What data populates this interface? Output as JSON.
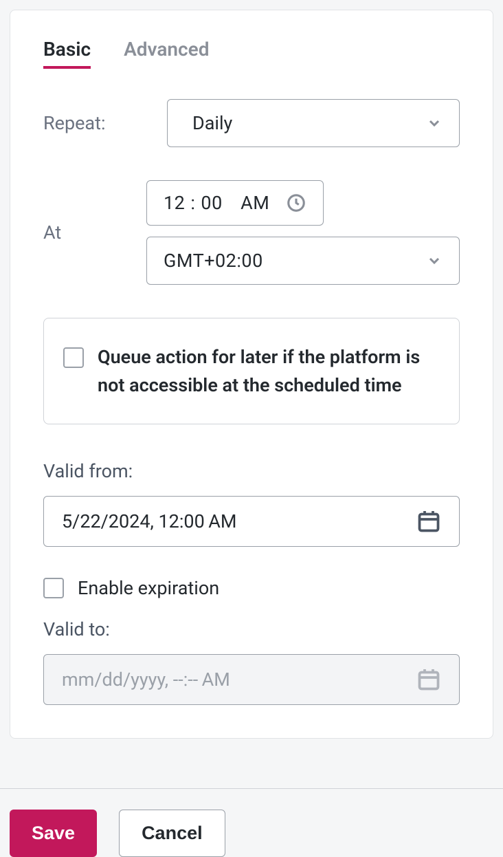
{
  "tabs": {
    "basic": "Basic",
    "advanced": "Advanced"
  },
  "repeat": {
    "label": "Repeat:",
    "value": "Daily"
  },
  "at": {
    "label": "At",
    "hours": "12",
    "minutes": "00",
    "ampm": "AM",
    "timezone": "GMT+02:00"
  },
  "queue": {
    "text": "Queue action for later if the platform is not accessible at the scheduled time"
  },
  "valid_from": {
    "label": "Valid from:",
    "value": "5/22/2024, 12:00 AM"
  },
  "expiration": {
    "label": "Enable expiration"
  },
  "valid_to": {
    "label": "Valid to:",
    "placeholder": "mm/dd/yyyy, --:-- AM"
  },
  "buttons": {
    "save": "Save",
    "cancel": "Cancel"
  }
}
